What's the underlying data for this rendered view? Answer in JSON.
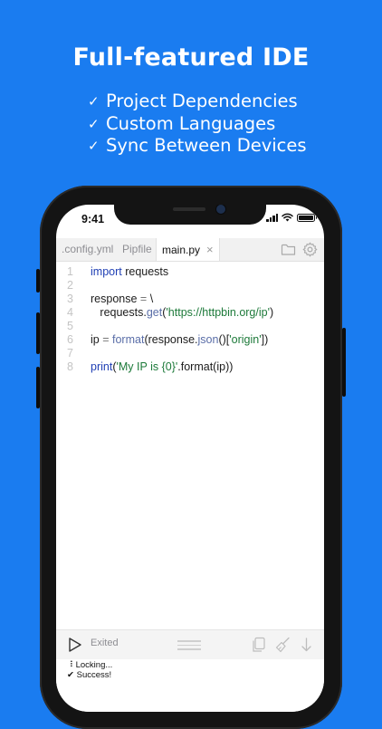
{
  "headline": "Full-featured IDE",
  "features": [
    {
      "icon": "checkmark-icon",
      "label": "Project Dependencies"
    },
    {
      "icon": "checkmark-icon",
      "label": "Custom Languages"
    },
    {
      "icon": "checkmark-icon",
      "label": "Sync Between Devices"
    }
  ],
  "status_bar": {
    "time": "9:41"
  },
  "tabs": [
    {
      "label": ".config.yml",
      "active": false
    },
    {
      "label": "Pipfile",
      "active": false
    },
    {
      "label": "main.py",
      "active": true,
      "close": "×"
    }
  ],
  "editor": {
    "lines": [
      {
        "n": "1",
        "tokens": [
          {
            "t": "import",
            "c": "kw"
          },
          {
            "t": " requests",
            "c": ""
          }
        ]
      },
      {
        "n": "2",
        "tokens": []
      },
      {
        "n": "3",
        "tokens": [
          {
            "t": "response ",
            "c": ""
          },
          {
            "t": "=",
            "c": "op"
          },
          {
            "t": " \\",
            "c": ""
          }
        ]
      },
      {
        "n": "4",
        "tokens": [
          {
            "t": "   requests.",
            "c": ""
          },
          {
            "t": "get",
            "c": "fn"
          },
          {
            "t": "(",
            "c": ""
          },
          {
            "t": "'https://httpbin.org/ip'",
            "c": "str"
          },
          {
            "t": ")",
            "c": ""
          }
        ]
      },
      {
        "n": "5",
        "tokens": []
      },
      {
        "n": "6",
        "tokens": [
          {
            "t": "ip ",
            "c": ""
          },
          {
            "t": "=",
            "c": "op"
          },
          {
            "t": " ",
            "c": ""
          },
          {
            "t": "format",
            "c": "fn"
          },
          {
            "t": "(response.",
            "c": ""
          },
          {
            "t": "json",
            "c": "fn"
          },
          {
            "t": "()[",
            "c": ""
          },
          {
            "t": "'origin'",
            "c": "str"
          },
          {
            "t": "])",
            "c": ""
          }
        ]
      },
      {
        "n": "7",
        "tokens": []
      },
      {
        "n": "8",
        "tokens": [
          {
            "t": "print",
            "c": "kw"
          },
          {
            "t": "(",
            "c": ""
          },
          {
            "t": "'My IP is {0}'",
            "c": "str"
          },
          {
            "t": ".format(ip))",
            "c": ""
          }
        ]
      }
    ]
  },
  "toolbar": {
    "run_icon": "play-icon",
    "status": "Exited"
  },
  "console": {
    "lines": [
      {
        "prefix": "⠸",
        "text": "Locking..."
      },
      {
        "prefix": "✔",
        "text": "Success!"
      }
    ]
  },
  "colors": {
    "background": "#1a7cf0",
    "keyword": "#1f3fb4",
    "string": "#1d7a3a",
    "line_number": "#c4c4c4"
  }
}
